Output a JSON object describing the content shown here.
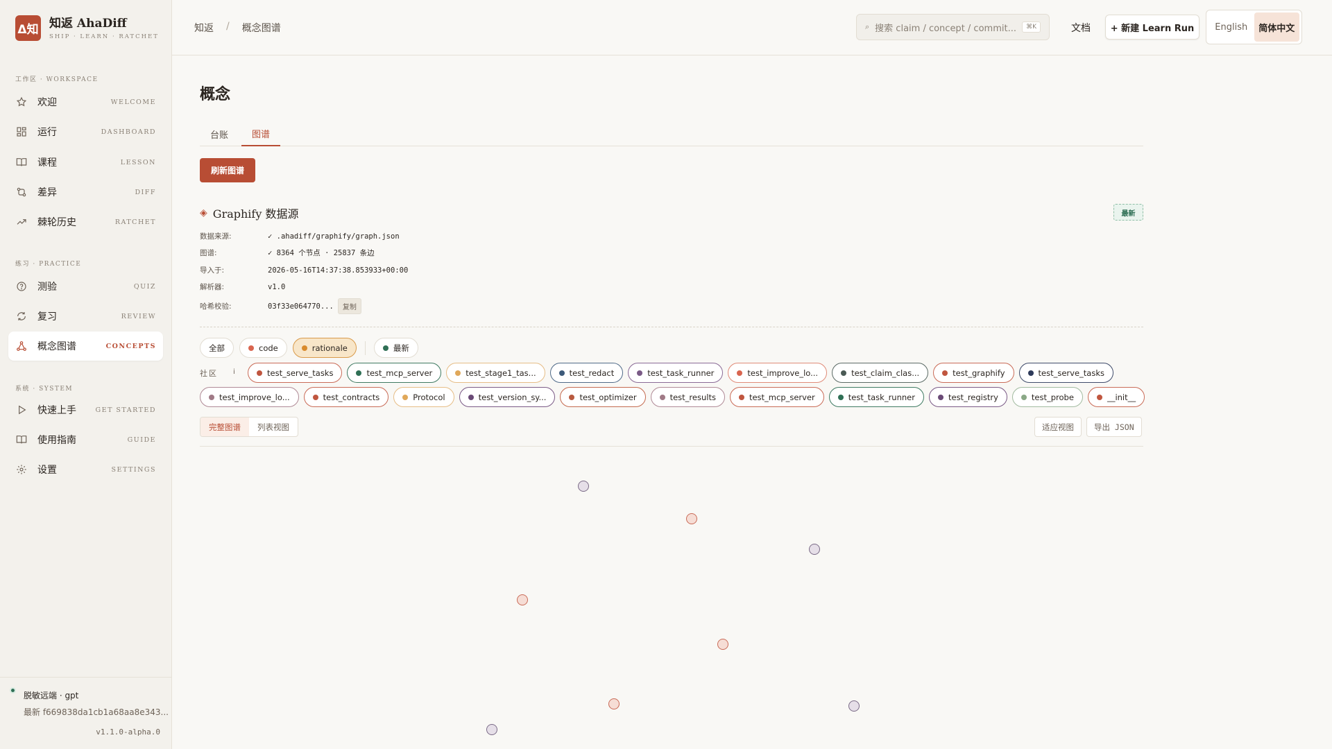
{
  "brand": {
    "logo": "Δ知",
    "title": "知返 AhaDiff",
    "subtitle": "SHIP · LEARN · RATCHET"
  },
  "sidebar": {
    "sections": [
      {
        "label": "工作区 · WORKSPACE",
        "items": [
          {
            "label": "欢迎",
            "tag": "WELCOME",
            "icon": "star-icon"
          },
          {
            "label": "运行",
            "tag": "DASHBOARD",
            "icon": "dashboard-icon"
          },
          {
            "label": "课程",
            "tag": "LESSON",
            "icon": "book-icon"
          },
          {
            "label": "差异",
            "tag": "DIFF",
            "icon": "diff-icon"
          },
          {
            "label": "棘轮历史",
            "tag": "RATCHET",
            "icon": "trend-icon"
          }
        ]
      },
      {
        "label": "练习 · PRACTICE",
        "items": [
          {
            "label": "测验",
            "tag": "QUIZ",
            "icon": "help-circle-icon"
          },
          {
            "label": "复习",
            "tag": "REVIEW",
            "icon": "refresh-icon"
          },
          {
            "label": "概念图谱",
            "tag": "CONCEPTS",
            "icon": "graph-icon",
            "active": true
          }
        ]
      },
      {
        "label": "系统 · SYSTEM",
        "items": [
          {
            "label": "快速上手",
            "tag": "GET STARTED",
            "icon": "play-icon"
          },
          {
            "label": "使用指南",
            "tag": "GUIDE",
            "icon": "book-icon"
          },
          {
            "label": "设置",
            "tag": "SETTINGS",
            "icon": "gear-icon"
          }
        ]
      }
    ],
    "footer": {
      "status": "脱敏远端 · gpt",
      "latest": "最新 f669838da1cb1a68aa8e343...",
      "version": "v1.1.0-alpha.0"
    }
  },
  "topbar": {
    "breadcrumb": [
      "知返",
      "/",
      "概念图谱"
    ],
    "search_placeholder": "搜索 claim / concept / commit...",
    "search_kbd": "⌘K",
    "docs": "文档",
    "new_run": "+ 新建 Learn Run",
    "lang": {
      "en": "English",
      "zh": "简体中文"
    }
  },
  "main": {
    "title": "概念",
    "tabs": [
      {
        "label": "台账"
      },
      {
        "label": "图谱",
        "active": true
      }
    ],
    "refresh": "刷新图谱",
    "source": {
      "title": "Graphify 数据源",
      "badge": "最新",
      "rows": [
        {
          "k": "数据来源:",
          "v": "✓ .ahadiff/graphify/graph.json"
        },
        {
          "k": "图谱:",
          "v": "✓ 8364 个节点 · 25837 条边"
        },
        {
          "k": "导入于:",
          "v": "2026-05-16T14:37:38.853933+00:00"
        },
        {
          "k": "解析器:",
          "v": "v1.0"
        },
        {
          "k": "哈希校验:",
          "v": "03f33e064770...",
          "copy": "复制"
        }
      ]
    },
    "filters": [
      {
        "label": "全部"
      },
      {
        "label": "code",
        "color": "#d9654f"
      },
      {
        "label": "rationale",
        "color": "#d98a2b",
        "active": true
      },
      {
        "label": "最新",
        "color": "#2f6f55"
      }
    ],
    "community_label": "社区",
    "community_info": "i",
    "communities_row1": [
      {
        "label": "test_serve_tasks",
        "color": "#c0563f",
        "border": "#c96b57"
      },
      {
        "label": "test_mcp_server",
        "color": "#2f6f55",
        "border": "#3f7a62"
      },
      {
        "label": "test_stage1_tas...",
        "color": "#e0a85a",
        "border": "#e6bd86"
      },
      {
        "label": "test_redact",
        "color": "#3d5a7a",
        "border": "#4f6a88"
      },
      {
        "label": "test_task_runner",
        "color": "#7a5a86",
        "border": "#8a6a96"
      },
      {
        "label": "test_improve_lo...",
        "color": "#d9654f",
        "border": "#e08b78"
      },
      {
        "label": "test_claim_clas...",
        "color": "#4a5a55",
        "border": "#5c6b66"
      },
      {
        "label": "test_graphify",
        "color": "#c0563f",
        "border": "#c96b57"
      },
      {
        "label": "test_serve_tasks",
        "color": "#2e3a5a",
        "border": "#3f4b6a"
      }
    ],
    "communities_row2": [
      {
        "label": "test_improve_lo...",
        "color": "#a07a86",
        "border": "#b08a96"
      },
      {
        "label": "test_contracts",
        "color": "#c0563f",
        "border": "#c96b57"
      },
      {
        "label": "Protocol",
        "color": "#e0a85a",
        "border": "#e6bd86"
      },
      {
        "label": "test_version_sy...",
        "color": "#6a4a76",
        "border": "#7a5a86"
      },
      {
        "label": "test_optimizer",
        "color": "#b85a3f",
        "border": "#c46a4f"
      },
      {
        "label": "test_results",
        "color": "#a07a86",
        "border": "#b08a96"
      },
      {
        "label": "test_mcp_server",
        "color": "#c0563f",
        "border": "#c96b57"
      },
      {
        "label": "test_task_runner",
        "color": "#2f6f55",
        "border": "#3f7a62"
      },
      {
        "label": "test_registry",
        "color": "#6a4a76",
        "border": "#7a5a86"
      },
      {
        "label": "test_probe",
        "color": "#8aa886",
        "border": "#a2bba0"
      },
      {
        "label": "__init__",
        "color": "#c0563f",
        "border": "#c96b57"
      }
    ],
    "view": {
      "full": "完整图谱",
      "list": "列表视图"
    },
    "fit": "适应视图",
    "export": "导出 JSON"
  },
  "graph_nodes": [
    {
      "kind": "concept",
      "fill": "#e6dfe8",
      "stroke": "#7a6a86"
    },
    {
      "kind": "rationale",
      "fill": "#f6ddd5",
      "stroke": "#c96b57"
    },
    {
      "kind": "concept",
      "fill": "#e6dfe8",
      "stroke": "#7a6a86"
    },
    {
      "kind": "rationale",
      "fill": "#f6ddd5",
      "stroke": "#c96b57"
    },
    {
      "kind": "rationale",
      "fill": "#f6ddd5",
      "stroke": "#c96b57"
    },
    {
      "kind": "rationale",
      "fill": "#f6ddd5",
      "stroke": "#c96b57"
    },
    {
      "kind": "concept",
      "fill": "#e6dfe8",
      "stroke": "#7a6a86"
    },
    {
      "kind": "concept",
      "fill": "#e6dfe8",
      "stroke": "#7a6a86"
    }
  ]
}
